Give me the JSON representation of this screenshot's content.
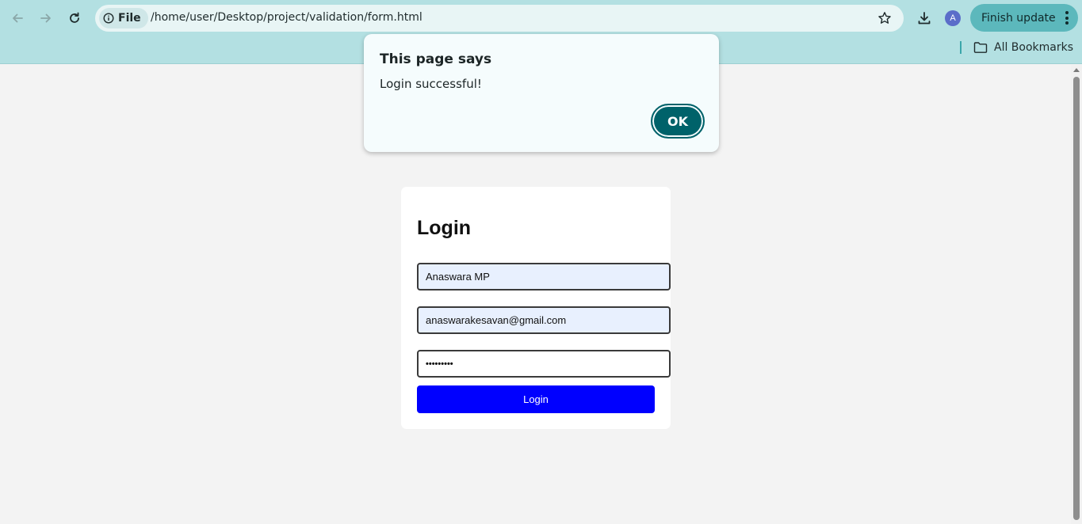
{
  "browser": {
    "url_scheme_chip": "File",
    "url": "/home/user/Desktop/project/validation/form.html",
    "profile_initial": "A",
    "update_button": "Finish update",
    "bookmarks_label": "All Bookmarks",
    "accent_color": "#b3e0e2"
  },
  "dialog": {
    "title": "This page says",
    "message": "Login successful!",
    "ok_label": "OK"
  },
  "form": {
    "heading": "Login",
    "name_value": "Anaswara MP",
    "email_value": "anaswarakesavan@gmail.com",
    "password_mask": "•••••••••",
    "submit_label": "Login",
    "submit_color": "#0000ff"
  }
}
